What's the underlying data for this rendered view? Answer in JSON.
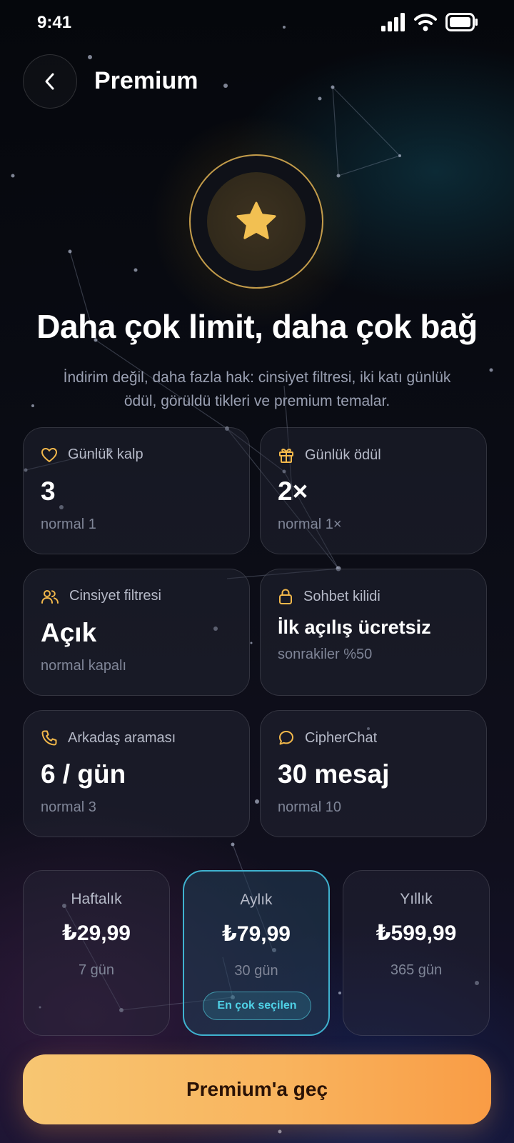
{
  "status_bar": {
    "time": "9:41"
  },
  "header": {
    "title": "Premium"
  },
  "hero": {
    "headline": "Daha çok limit, daha çok bağ",
    "subtitle": "İndirim değil, daha fazla hak: cinsiyet filtresi, iki katı günlük ödül, görüldü tikleri ve premium temalar."
  },
  "features": [
    {
      "icon": "heart-icon",
      "label": "Günlük kalp",
      "value": "3",
      "note": "normal 1"
    },
    {
      "icon": "gift-icon",
      "label": "Günlük ödül",
      "value": "2×",
      "note": "normal 1×"
    },
    {
      "icon": "users-icon",
      "label": "Cinsiyet filtresi",
      "value": "Açık",
      "note": "normal kapalı"
    },
    {
      "icon": "lock-icon",
      "label": "Sohbet kilidi",
      "value": "İlk açılış ücretsiz",
      "note": "sonrakiler %50"
    },
    {
      "icon": "phone-icon",
      "label": "Arkadaş araması",
      "value": "6 / gün",
      "note": "normal 3"
    },
    {
      "icon": "chat-icon",
      "label": "CipherChat",
      "value": "30 mesaj",
      "note": "normal 10"
    }
  ],
  "plans": [
    {
      "name": "Haftalık",
      "price": "₺29,99",
      "period": "7 gün"
    },
    {
      "name": "Aylık",
      "price": "₺79,99",
      "period": "30 gün",
      "badge": "En çok seçilen",
      "selected": true
    },
    {
      "name": "Yıllık",
      "price": "₺599,99",
      "period": "365 gün"
    }
  ],
  "cta": {
    "label": "Premium'a geç"
  },
  "colors": {
    "accent_gold": "#f2b84b",
    "selected_cyan": "#3fb2cf",
    "cta_start": "#f7c672",
    "cta_end": "#f99c45"
  },
  "background": {
    "style": "constellation"
  }
}
